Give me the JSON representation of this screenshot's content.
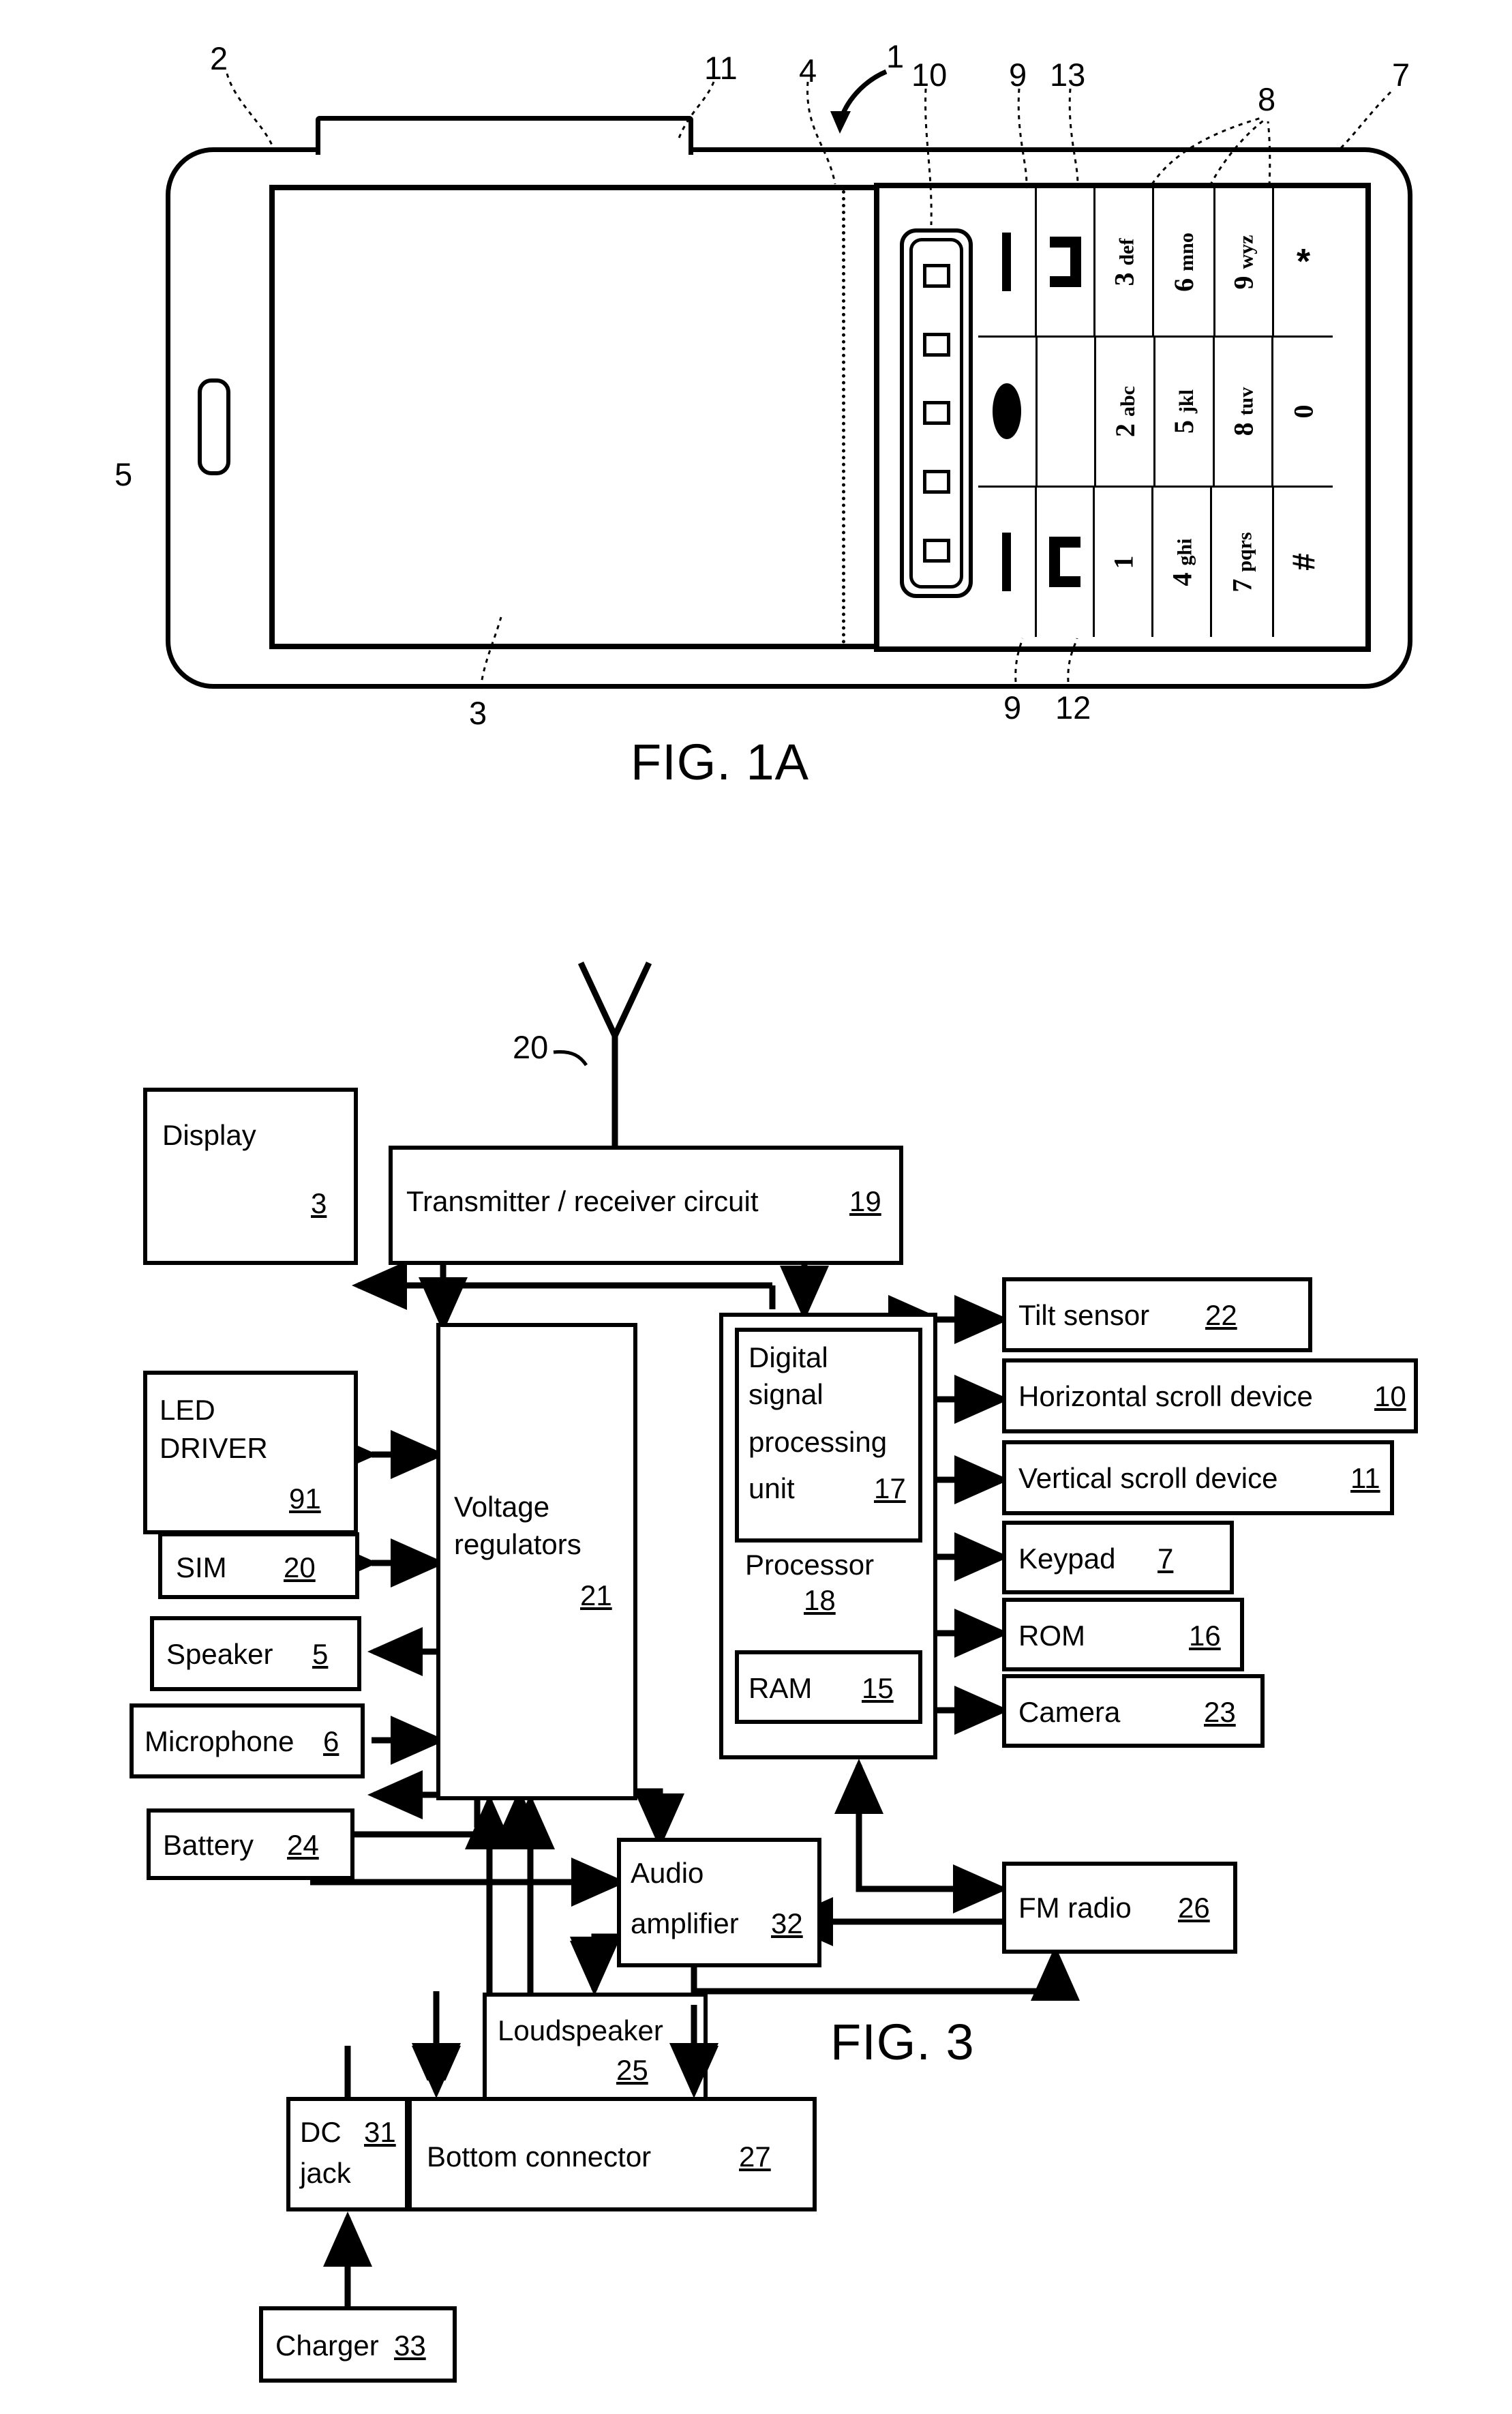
{
  "figures": [
    {
      "id": "fig1a",
      "caption": "FIG. 1A"
    },
    {
      "id": "fig3",
      "caption": "FIG. 3"
    }
  ],
  "fig1a": {
    "caption": "FIG. 1A",
    "reference_numerals": {
      "device": "1",
      "housing": "2",
      "display": "3",
      "display_edge": "4",
      "speaker": "5",
      "keypad": "7",
      "keys": "8",
      "key_separators": "9",
      "horizontal_scroll_device": "10",
      "vertical_scroll_device": "11",
      "soft_key_left": "12",
      "soft_key_right": "13"
    },
    "labels": {
      "n1": "1",
      "n2": "2",
      "n3": "3",
      "n4": "4",
      "n5": "5",
      "n7": "7",
      "n8": "8",
      "n9_top": "9",
      "n9_bottom": "9",
      "n10": "10",
      "n11": "11",
      "n12": "12",
      "n13": "13"
    },
    "keypad": {
      "rows": [
        [
          {
            "type": "bar",
            "label": ""
          },
          {
            "type": "bracket",
            "label": ""
          },
          {
            "type": "text",
            "digit": "3",
            "letters": "def"
          },
          {
            "type": "text",
            "digit": "6",
            "letters": "mno"
          },
          {
            "type": "text",
            "digit": "9",
            "letters": "wyz"
          },
          {
            "type": "star",
            "label": "*"
          }
        ],
        [
          {
            "type": "ellipse",
            "label": ""
          },
          {
            "type": "blank",
            "label": ""
          },
          {
            "type": "text",
            "digit": "2",
            "letters": "abc"
          },
          {
            "type": "text",
            "digit": "5",
            "letters": "jkl"
          },
          {
            "type": "text",
            "digit": "8",
            "letters": "tuv"
          },
          {
            "type": "text",
            "digit": "0",
            "letters": ""
          }
        ],
        [
          {
            "type": "bar",
            "label": ""
          },
          {
            "type": "bracket-c",
            "label": ""
          },
          {
            "type": "text",
            "digit": "1",
            "letters": ""
          },
          {
            "type": "text",
            "digit": "4",
            "letters": "ghi"
          },
          {
            "type": "text",
            "digit": "7",
            "letters": "pqrs"
          },
          {
            "type": "hash",
            "label": "#"
          }
        ]
      ]
    }
  },
  "fig3": {
    "caption": "FIG. 3",
    "antenna_label": "20",
    "blocks": {
      "display": {
        "label": "Display",
        "num": "3"
      },
      "transmitter": {
        "label": "Transmitter / receiver circuit",
        "num": "19"
      },
      "led_driver": {
        "label": "LED\nDRIVER",
        "num": "91"
      },
      "sim": {
        "label": "SIM",
        "num": "20"
      },
      "speaker": {
        "label": "Speaker",
        "num": "5"
      },
      "microphone": {
        "label": "Microphone",
        "num": "6"
      },
      "battery": {
        "label": "Battery",
        "num": "24"
      },
      "voltage_reg": {
        "label": "Voltage\nregulators",
        "num": "21"
      },
      "dsp": {
        "label": "Digital\nsignal\nprocessing\nunit",
        "num": "17"
      },
      "processor": {
        "label": "Processor",
        "num": "18"
      },
      "ram": {
        "label": "RAM",
        "num": "15"
      },
      "tilt_sensor": {
        "label": "Tilt sensor",
        "num": "22"
      },
      "h_scroll": {
        "label": "Horizontal scroll device",
        "num": "10"
      },
      "v_scroll": {
        "label": "Vertical scroll device",
        "num": "11"
      },
      "keypad": {
        "label": "Keypad",
        "num": "7"
      },
      "rom": {
        "label": "ROM",
        "num": "16"
      },
      "camera": {
        "label": "Camera",
        "num": "23"
      },
      "fm_radio": {
        "label": "FM radio",
        "num": "26"
      },
      "audio_amp": {
        "label": "Audio\namplifier",
        "num": "32"
      },
      "loudspeaker": {
        "label": "Loudspeaker",
        "num": "25"
      },
      "dc_jack": {
        "label": "DC\njack",
        "num": "31"
      },
      "bottom_conn": {
        "label": "Bottom connector",
        "num": "27"
      },
      "charger": {
        "label": "Charger",
        "num": "33"
      }
    },
    "text": {
      "display_label": "Display",
      "display_num": "3",
      "transmitter_label": "Transmitter / receiver circuit",
      "transmitter_num": "19",
      "led_l1": "LED",
      "led_l2": "DRIVER",
      "led_num": "91",
      "sim_label": "SIM",
      "sim_num": "20",
      "speaker_label": "Speaker",
      "speaker_num": "5",
      "microphone_label": "Microphone",
      "microphone_num": "6",
      "battery_label": "Battery",
      "battery_num": "24",
      "vreg_l1": "Voltage",
      "vreg_l2": "regulators",
      "vreg_num": "21",
      "dsp_l1": "Digital",
      "dsp_l2": "signal",
      "dsp_l3": "processing",
      "dsp_l4": "unit",
      "dsp_num": "17",
      "proc_label": "Processor",
      "proc_num": "18",
      "ram_label": "RAM",
      "ram_num": "15",
      "tilt_label": "Tilt sensor",
      "tilt_num": "22",
      "hscroll_label": "Horizontal scroll device",
      "hscroll_num": "10",
      "vscroll_label": "Vertical scroll device",
      "vscroll_num": "11",
      "keypad_label": "Keypad",
      "keypad_num": "7",
      "rom_label": "ROM",
      "rom_num": "16",
      "camera_label": "Camera",
      "camera_num": "23",
      "fm_label": "FM radio",
      "fm_num": "26",
      "amp_l1": "Audio",
      "amp_l2": "amplifier",
      "amp_num": "32",
      "loud_label": "Loudspeaker",
      "loud_num": "25",
      "dc_l1": "DC",
      "dc_l2": "jack",
      "dc_num": "31",
      "bconn_label": "Bottom connector",
      "bconn_num": "27",
      "charger_label": "Charger",
      "charger_num": "33",
      "antenna_num": "20"
    }
  },
  "colors": {
    "ink": "#000000",
    "paper": "#ffffff"
  }
}
